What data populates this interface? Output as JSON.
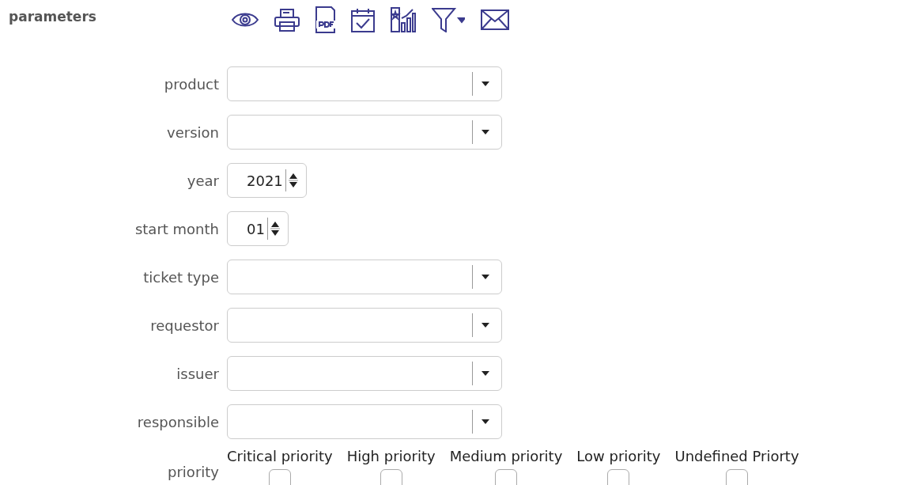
{
  "title": "parameters",
  "fields": [
    {
      "label": "product",
      "kind": "select"
    },
    {
      "label": "version",
      "kind": "select"
    },
    {
      "label": "year",
      "kind": "spinner",
      "value": "2021"
    },
    {
      "label": "start month",
      "kind": "spinner",
      "value": "01"
    },
    {
      "label": "ticket type",
      "kind": "select"
    },
    {
      "label": "requestor",
      "kind": "select"
    },
    {
      "label": "issuer",
      "kind": "select"
    },
    {
      "label": "responsible",
      "kind": "select"
    }
  ],
  "priority": {
    "label": "priority",
    "options": [
      {
        "label": "Critical priority",
        "checked": false
      },
      {
        "label": "High priority",
        "checked": false
      },
      {
        "label": "Medium priority",
        "checked": false
      },
      {
        "label": "Low priority",
        "checked": false
      },
      {
        "label": "Undefined Priorty",
        "checked": false
      }
    ]
  }
}
